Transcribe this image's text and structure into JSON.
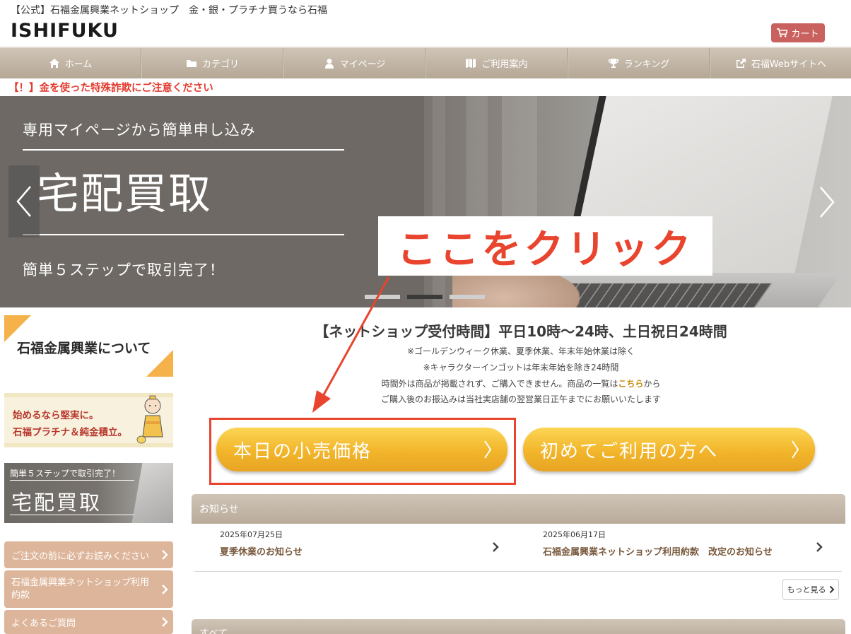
{
  "header": {
    "site_title": "【公式】石福金属興業ネットショップ　金・銀・プラチナ買うなら石福",
    "logo": "ISHIFUKU",
    "cart_label": "カート"
  },
  "nav": {
    "items": [
      {
        "label": "ホーム",
        "icon": "home-icon"
      },
      {
        "label": "カテゴリ",
        "icon": "folder-icon"
      },
      {
        "label": "マイページ",
        "icon": "user-icon"
      },
      {
        "label": "ご利用案内",
        "icon": "map-icon"
      },
      {
        "label": "ランキング",
        "icon": "trophy-icon"
      },
      {
        "label": "石福Webサイトへ",
        "icon": "external-link-icon"
      }
    ]
  },
  "warning": "【！】金を使った特殊詐欺にご注意ください",
  "banner": {
    "subtitle": "専用マイページから簡単申し込み",
    "title": "宅配買取",
    "caption": "簡単５ステップで取引完了！",
    "slides": 3,
    "active_slide": 2
  },
  "annotation": {
    "callout": "ここをクリック",
    "color": "#e8442e"
  },
  "sidebar": {
    "about": "石福金属興業について",
    "plat_line1": "始めるなら堅実に。",
    "plat_line2": "石福プラチナ＆純金積立。",
    "banner_caption": "簡単５ステップで取引完了！",
    "banner_title": "宅配買取",
    "links": [
      "ご注文の前に必ずお読みください",
      "石福金属興業ネットショップ利用約款",
      "よくあるご質問"
    ]
  },
  "main": {
    "hours": "【ネットショップ受付時間】平日10時〜24時、土日祝日24時間",
    "note1": "※ゴールデンウィーク休業、夏季休業、年末年始休業は除く",
    "note2": "※キャラクターインゴットは年末年始を除き24時間",
    "note3_pre": "時間外は商品が掲載されず、ご購入できません。商品の一覧は",
    "note3_link": "こちら",
    "note3_post": "から",
    "note4": "ご購入後のお振込みは当社実店舗の翌営業日正午までにお願いいたします",
    "btn_retail": "本日の小売価格",
    "btn_first": "初めてご利用の方へ"
  },
  "news": {
    "heading": "お知らせ",
    "items": [
      {
        "date": "2025年07月25日",
        "title": "夏季休業のお知らせ"
      },
      {
        "date": "2025年06月17日",
        "title": "石福金属興業ネットショップ利用約款　改定のお知らせ"
      }
    ],
    "more": "もっと見る"
  },
  "all_heading": "すべて",
  "colors": {
    "nav_bg": "#b5a796",
    "cart_bg": "#c9625e",
    "warning": "#e33b2e",
    "gold_button": "#f2b52a",
    "sidebar_link": "#ddb59a",
    "news_title": "#7a5a3e"
  }
}
